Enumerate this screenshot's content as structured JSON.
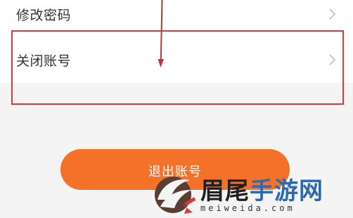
{
  "settings": {
    "items": [
      {
        "label": "修改密码",
        "icon": "chevron-right-icon"
      },
      {
        "label": "关闭账号",
        "icon": "chevron-right-icon"
      }
    ]
  },
  "logout": {
    "label": "退出账号"
  },
  "colors": {
    "accent": "#f47129",
    "highlight": "#d63b3b",
    "chevron": "#c8c8c8"
  }
}
